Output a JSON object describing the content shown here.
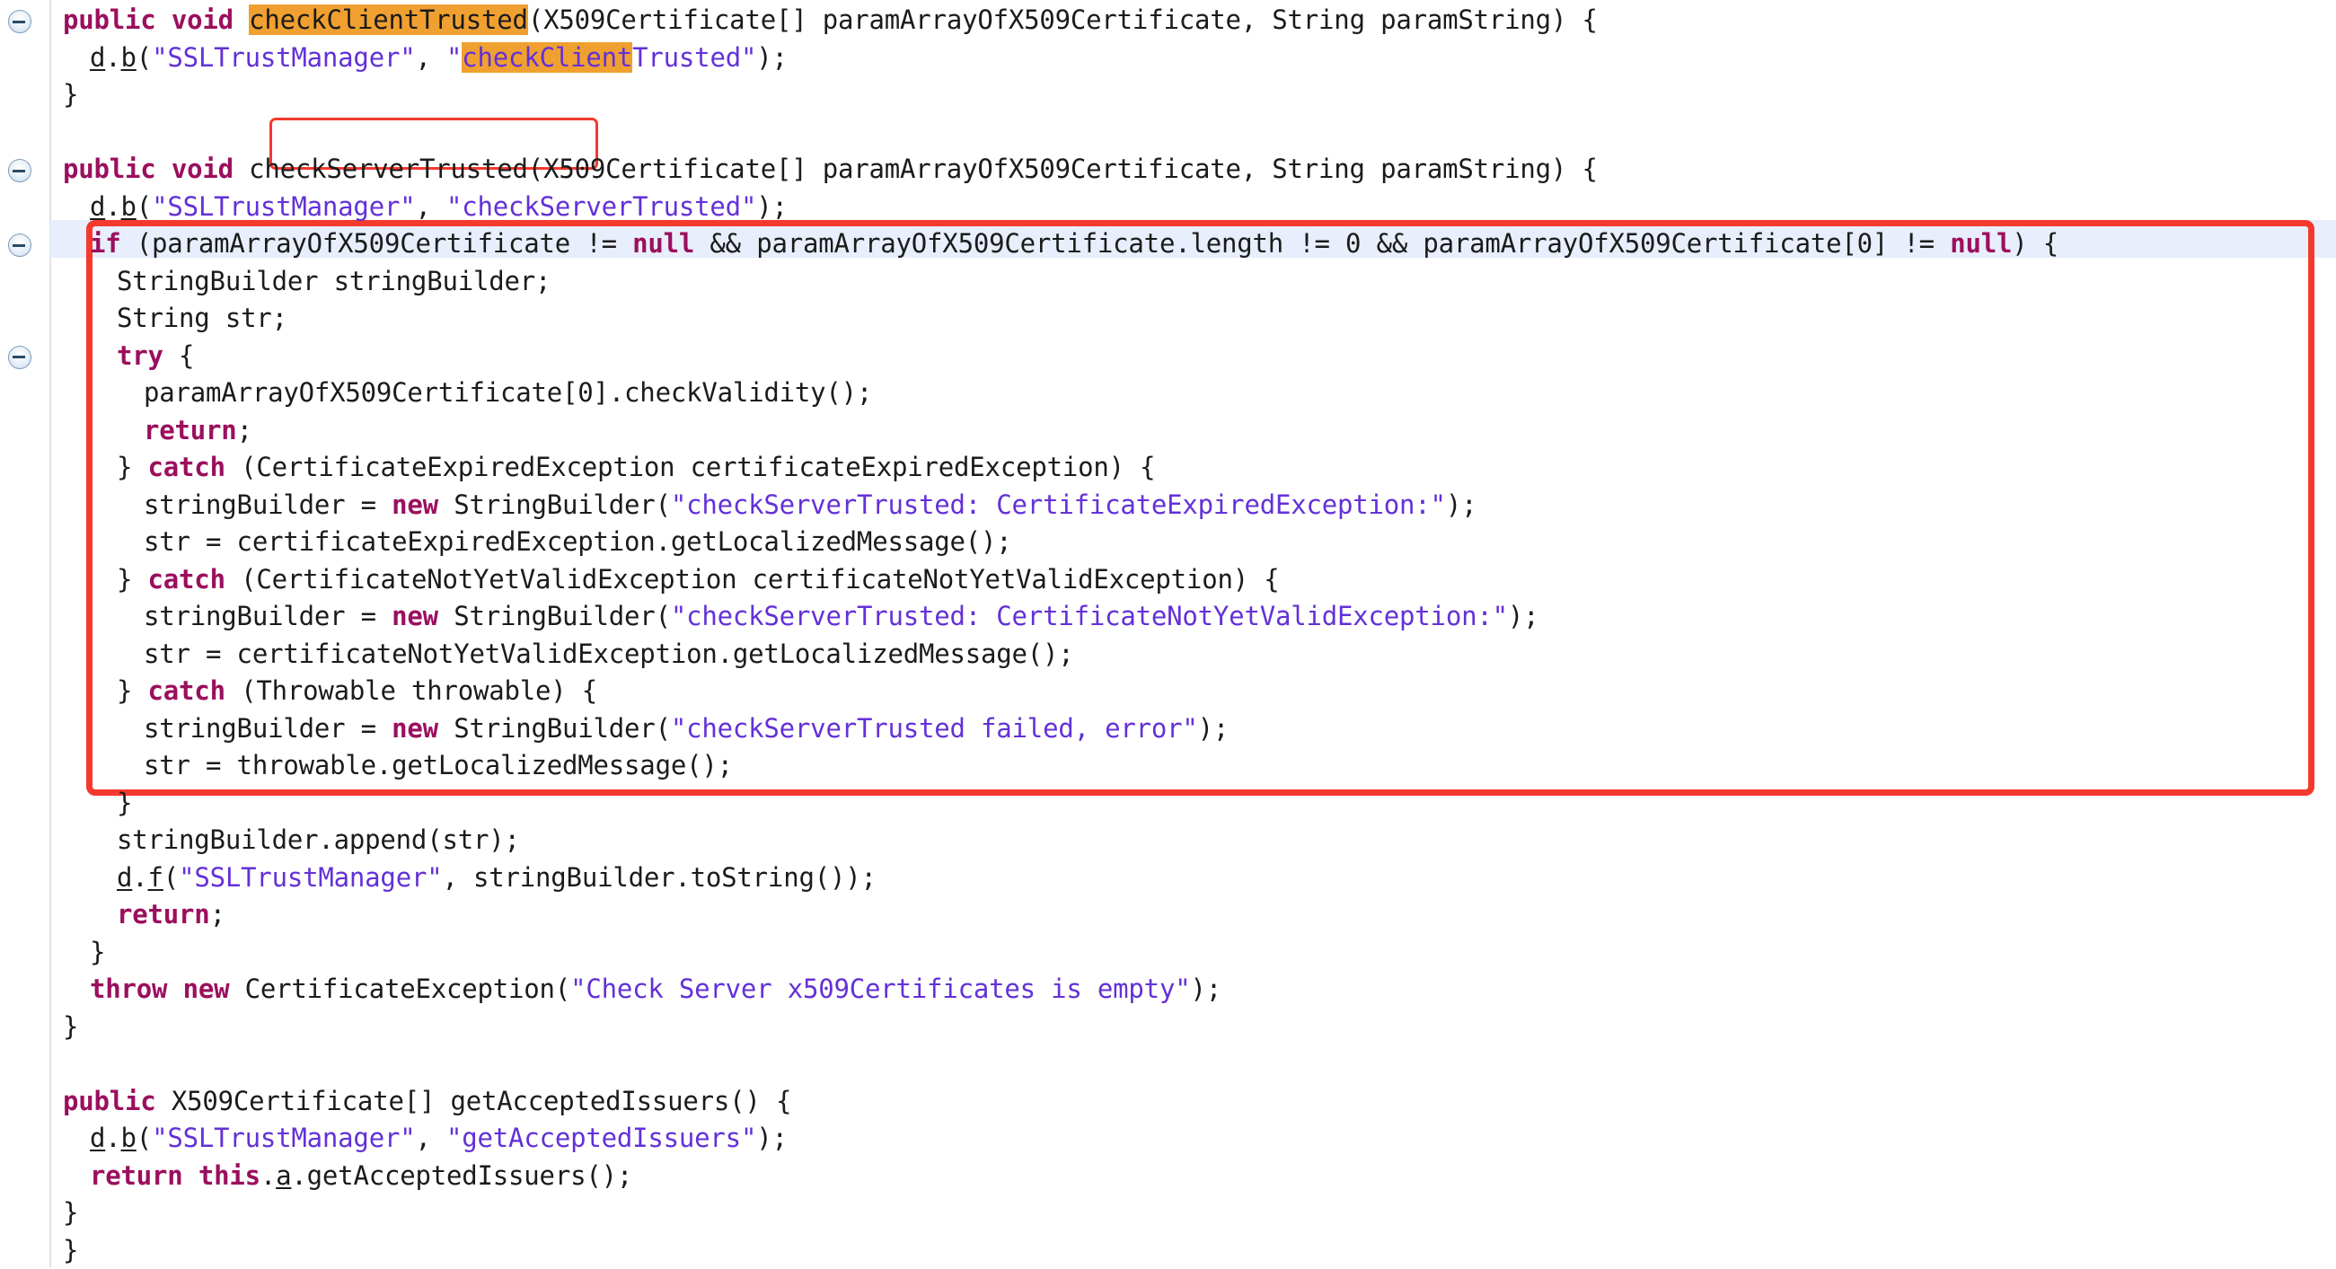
{
  "editor": {
    "language": "java",
    "file_kind": "decompiled-java-source",
    "background_color": "#ffffff",
    "foreground_color": "#1b1b1b",
    "keyword_color": "#9b0f5e",
    "string_color": "#6331d8",
    "search_highlight_color": "#f0a030",
    "current_line_color": "#e8eefb",
    "annotation_color": "#f4392f"
  },
  "gutter": {
    "fold_icon_name": "collapse-fold-icon",
    "fold_markers": [
      {
        "label": "collapse",
        "line_index": 0
      },
      {
        "label": "collapse",
        "line_index": 4
      },
      {
        "label": "collapse",
        "line_index": 6
      },
      {
        "label": "collapse",
        "line_index": 9
      }
    ]
  },
  "annotations": [
    {
      "name": "method-name-callout",
      "target": "checkServerTrusted",
      "shape": "rectangle",
      "color": "#f4392f"
    },
    {
      "name": "certificate-validation-block-callout",
      "target": "if (paramArrayOfX509Certificate != null ...) { ... }",
      "shape": "rectangle",
      "color": "#f4392f"
    }
  ],
  "search": {
    "term": "checkClientTrusted",
    "occurrences": 2
  },
  "lines": [
    {
      "n": 0,
      "indent": 1,
      "html": "<span class=\"kw\">public</span> <span class=\"kw\">void</span> <span class=\"hl\">checkClientTrusted</span>(X509Certificate[] paramArrayOfX509Certificate, String paramString) {"
    },
    {
      "n": 1,
      "indent": 2,
      "html": "<span class=\"und\">d</span>.<span class=\"und\">b</span>(<span class=\"str\">\"SSLTrustManager\"</span>, <span class=\"str\">\"</span><span class=\"str hl\">checkClient</span><span class=\"str\">Trusted\"</span>);"
    },
    {
      "n": 2,
      "indent": 1,
      "html": "}"
    },
    {
      "n": 3,
      "indent": 0,
      "html": ""
    },
    {
      "n": 4,
      "indent": 1,
      "html": "<span class=\"kw\">public</span> <span class=\"kw\">void</span> checkServerTrusted(X509Certificate[] paramArrayOfX509Certificate, String paramString) {"
    },
    {
      "n": 5,
      "indent": 2,
      "html": "<span class=\"und\">d</span>.<span class=\"und\">b</span>(<span class=\"str\">\"SSLTrustManager\"</span>, <span class=\"str\">\"checkServerTrusted\"</span>);"
    },
    {
      "n": 6,
      "indent": 2,
      "html": "<span class=\"kw\">if</span> (paramArrayOfX509Certificate != <span class=\"kw\">null</span> &amp;&amp; paramArrayOfX509Certificate.length != 0 &amp;&amp; paramArrayOfX509Certificate[0] != <span class=\"kw\">null</span>) {"
    },
    {
      "n": 7,
      "indent": 3,
      "html": "StringBuilder stringBuilder;"
    },
    {
      "n": 8,
      "indent": 3,
      "html": "String str;"
    },
    {
      "n": 9,
      "indent": 3,
      "html": "<span class=\"kw\">try</span> {"
    },
    {
      "n": 10,
      "indent": 4,
      "html": "paramArrayOfX509Certificate[0].checkValidity();"
    },
    {
      "n": 11,
      "indent": 4,
      "html": "<span class=\"kw\">return</span>;"
    },
    {
      "n": 12,
      "indent": 3,
      "html": "} <span class=\"kw\">catch</span> (CertificateExpiredException certificateExpiredException) {"
    },
    {
      "n": 13,
      "indent": 4,
      "html": "stringBuilder = <span class=\"kw\">new</span> StringBuilder(<span class=\"str\">\"checkServerTrusted: CertificateExpiredException:\"</span>);"
    },
    {
      "n": 14,
      "indent": 4,
      "html": "str = certificateExpiredException.getLocalizedMessage();"
    },
    {
      "n": 15,
      "indent": 3,
      "html": "} <span class=\"kw\">catch</span> (CertificateNotYetValidException certificateNotYetValidException) {"
    },
    {
      "n": 16,
      "indent": 4,
      "html": "stringBuilder = <span class=\"kw\">new</span> StringBuilder(<span class=\"str\">\"checkServerTrusted: CertificateNotYetValidException:\"</span>);"
    },
    {
      "n": 17,
      "indent": 4,
      "html": "str = certificateNotYetValidException.getLocalizedMessage();"
    },
    {
      "n": 18,
      "indent": 3,
      "html": "} <span class=\"kw\">catch</span> (Throwable throwable) {"
    },
    {
      "n": 19,
      "indent": 4,
      "html": "stringBuilder = <span class=\"kw\">new</span> StringBuilder(<span class=\"str\">\"checkServerTrusted failed, error\"</span>);"
    },
    {
      "n": 20,
      "indent": 4,
      "html": "str = throwable.getLocalizedMessage();"
    },
    {
      "n": 21,
      "indent": 3,
      "html": "}"
    },
    {
      "n": 22,
      "indent": 3,
      "html": "stringBuilder.append(str);"
    },
    {
      "n": 23,
      "indent": 3,
      "html": "<span class=\"und\">d</span>.<span class=\"und\">f</span>(<span class=\"str\">\"SSLTrustManager\"</span>, stringBuilder.toString());"
    },
    {
      "n": 24,
      "indent": 3,
      "html": "<span class=\"kw\">return</span>;"
    },
    {
      "n": 25,
      "indent": 2,
      "html": "}"
    },
    {
      "n": 26,
      "indent": 2,
      "html": "<span class=\"kw\">throw</span> <span class=\"kw\">new</span> CertificateException(<span class=\"str\">\"Check Server x509Certificates is empty\"</span>);"
    },
    {
      "n": 27,
      "indent": 1,
      "html": "}"
    },
    {
      "n": 28,
      "indent": 0,
      "html": ""
    },
    {
      "n": 29,
      "indent": 1,
      "html": "<span class=\"kw\">public</span> X509Certificate[] getAcceptedIssuers() {"
    },
    {
      "n": 30,
      "indent": 2,
      "html": "<span class=\"und\">d</span>.<span class=\"und\">b</span>(<span class=\"str\">\"SSLTrustManager\"</span>, <span class=\"str\">\"getAcceptedIssuers\"</span>);"
    },
    {
      "n": 31,
      "indent": 2,
      "html": "<span class=\"kw\">return</span> <span class=\"kw\">this</span>.<span class=\"und\">a</span>.getAcceptedIssuers();"
    },
    {
      "n": 32,
      "indent": 1,
      "html": "}"
    },
    {
      "n": 33,
      "indent": 0,
      "html": "}"
    }
  ],
  "plain_text_lines": [
    "  public void checkClientTrusted(X509Certificate[] paramArrayOfX509Certificate, String paramString) {",
    "    d.b(\"SSLTrustManager\", \"checkClientTrusted\");",
    "  }",
    "",
    "  public void checkServerTrusted(X509Certificate[] paramArrayOfX509Certificate, String paramString) {",
    "    d.b(\"SSLTrustManager\", \"checkServerTrusted\");",
    "    if (paramArrayOfX509Certificate != null && paramArrayOfX509Certificate.length != 0 && paramArrayOfX509Certificate[0] != null) {",
    "      StringBuilder stringBuilder;",
    "      String str;",
    "      try {",
    "        paramArrayOfX509Certificate[0].checkValidity();",
    "        return;",
    "      } catch (CertificateExpiredException certificateExpiredException) {",
    "        stringBuilder = new StringBuilder(\"checkServerTrusted: CertificateExpiredException:\");",
    "        str = certificateExpiredException.getLocalizedMessage();",
    "      } catch (CertificateNotYetValidException certificateNotYetValidException) {",
    "        stringBuilder = new StringBuilder(\"checkServerTrusted: CertificateNotYetValidException:\");",
    "        str = certificateNotYetValidException.getLocalizedMessage();",
    "      } catch (Throwable throwable) {",
    "        stringBuilder = new StringBuilder(\"checkServerTrusted failed, error\");",
    "        str = throwable.getLocalizedMessage();",
    "      }",
    "      stringBuilder.append(str);",
    "      d.f(\"SSLTrustManager\", stringBuilder.toString());",
    "      return;",
    "    }",
    "    throw new CertificateException(\"Check Server x509Certificates is empty\");",
    "  }",
    "",
    "  public X509Certificate[] getAcceptedIssuers() {",
    "    d.b(\"SSLTrustManager\", \"getAcceptedIssuers\");",
    "    return this.a.getAcceptedIssuers();",
    "  }",
    "}"
  ]
}
